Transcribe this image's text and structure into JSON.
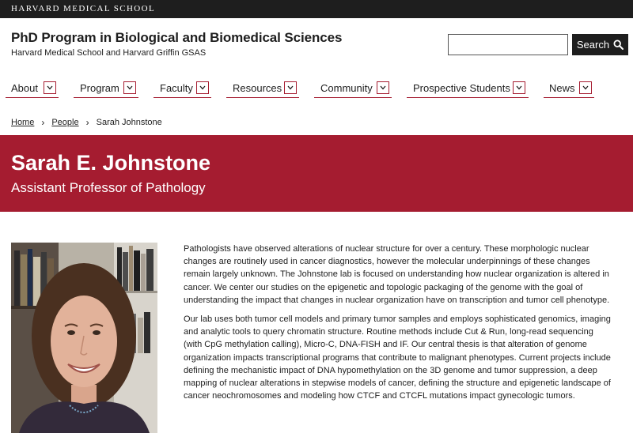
{
  "topbar": {
    "brand": "HARVARD MEDICAL SCHOOL"
  },
  "header": {
    "title": "PhD Program in Biological and Biomedical Sciences",
    "subtitle": "Harvard Medical School and Harvard Griffin GSAS"
  },
  "search": {
    "placeholder": "",
    "value": "",
    "button_label": "Search",
    "icon": "search-icon"
  },
  "nav": {
    "items": [
      {
        "label": "About"
      },
      {
        "label": "Program"
      },
      {
        "label": "Faculty"
      },
      {
        "label": "Resources"
      },
      {
        "label": "Community"
      },
      {
        "label": "Prospective Students"
      },
      {
        "label": "News"
      }
    ],
    "toggle_icon": "chevron-down-icon"
  },
  "breadcrumb": {
    "home": "Home",
    "people": "People",
    "current": "Sarah Johnstone",
    "separator": "›"
  },
  "profile": {
    "name": "Sarah E. Johnstone",
    "position": "Assistant Professor of Pathology",
    "photo_alt": "Portrait of Sarah E. Johnstone",
    "bio": [
      "Pathologists have observed alterations of nuclear structure for over a century. These morphologic nuclear changes are routinely used in cancer diagnostics, however the molecular underpinnings of these changes remain largely unknown. The Johnstone lab is focused on understanding how nuclear organization is altered in cancer. We center our studies on the epigenetic and topologic packaging of the genome with the goal of understanding the impact that changes in nuclear organization have on transcription and tumor cell phenotype.",
      "Our lab uses both tumor cell models and primary tumor samples and employs sophisticated genomics, imaging and analytic tools to query chromatin structure.  Routine methods include Cut & Run, long-read sequencing (with CpG methylation calling), Micro-C, DNA-FISH and IF.  Our central thesis is that alteration of genome organization impacts transcriptional programs that contribute to malignant phenotypes.  Current projects include defining the mechanistic impact of DNA hypomethylation on the 3D genome and tumor suppression, a deep mapping of nuclear alterations in stepwise models of cancer, defining the structure and epigenetic landscape of cancer neochromosomes and modeling how CTCF and CTCFL mutations impact gynecologic tumors."
    ]
  },
  "colors": {
    "brand_crimson": "#a51c30",
    "topbar": "#1e1e1e",
    "text": "#1e1e1e"
  }
}
